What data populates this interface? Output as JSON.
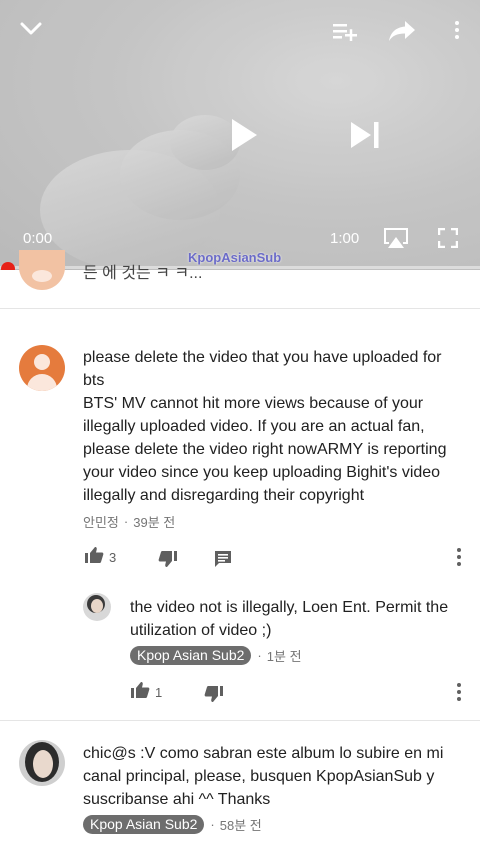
{
  "player": {
    "current_time": "0:00",
    "duration": "1:00",
    "watermark": "KpopAsianSub",
    "progress": 0.0,
    "accent_color": "#e62117"
  },
  "partial_comment": {
    "text": "든 에 것는 ㅋ ㅋ..."
  },
  "comments": [
    {
      "text": "please delete the video that you have uploaded for bts\nBTS' MV cannot hit more views because of your illegally uploaded video. If you are an actual fan, please delete the video right nowARMY is reporting your video since you keep uploading Bighit's video illegally and disregarding their copyright",
      "author": "안민정",
      "separator": "·",
      "time": "39분 전",
      "likes": "3"
    }
  ],
  "reply": {
    "text": "the video not is illegally, Loen Ent. Permit the utilization of video ;)",
    "author_badge": "Kpop Asian Sub2",
    "separator": "·",
    "time": "1분 전",
    "likes": "1"
  },
  "comment2": {
    "text": "chic@s :V como sabran este album lo subire en mi canal principal, please, busquen KpopAsianSub y suscribanse ahi ^^ Thanks",
    "author_badge": "Kpop Asian Sub2",
    "separator": "·",
    "time": "58분 전"
  }
}
